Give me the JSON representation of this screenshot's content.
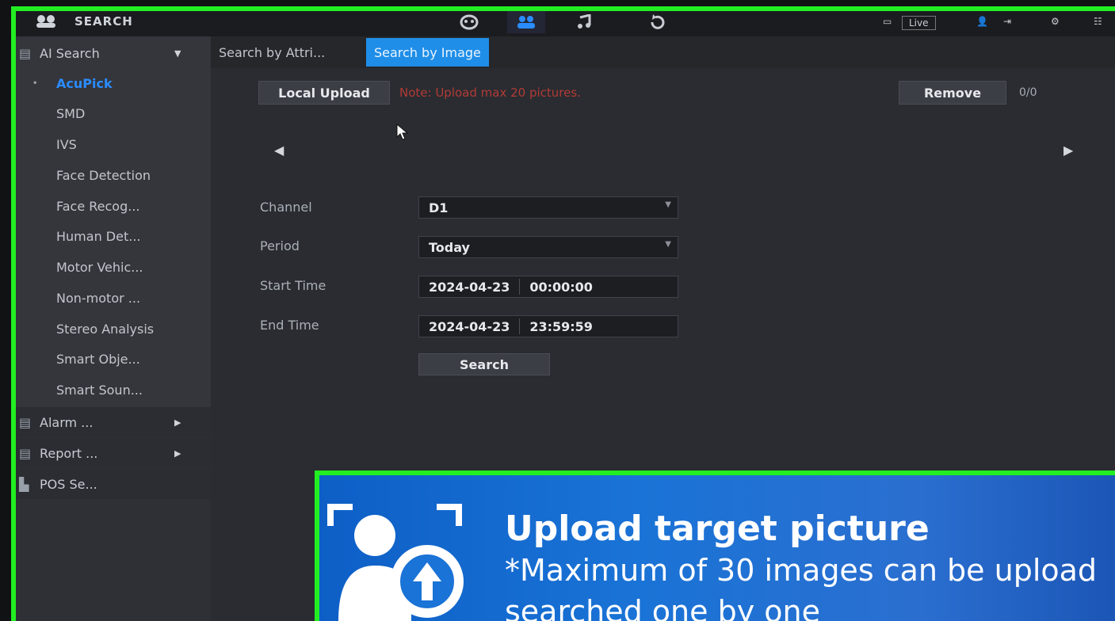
{
  "topbar": {
    "title": "SEARCH",
    "live": "Live"
  },
  "sidebar": {
    "ai_search": "AI Search",
    "sub_items": [
      "AcuPick",
      "SMD",
      "IVS",
      "Face Detection",
      "Face Recog...",
      "Human Det...",
      "Motor Vehic...",
      "Non-motor ...",
      "Stereo Analysis",
      "Smart Obje...",
      "Smart Soun..."
    ],
    "alarm": "Alarm ...",
    "report": "Report ...",
    "pos": "POS Se..."
  },
  "tabs": {
    "by_attr": "Search by Attri...",
    "by_image": "Search by Image"
  },
  "upload": {
    "button": "Local Upload",
    "note": "Note: Upload max 20 pictures.",
    "remove": "Remove",
    "count": "0/0"
  },
  "form": {
    "channel_label": "Channel",
    "channel_value": "D1",
    "period_label": "Period",
    "period_value": "Today",
    "start_label": "Start Time",
    "start_date": "2024-04-23",
    "start_time": "00:00:00",
    "end_label": "End Time",
    "end_date": "2024-04-23",
    "end_time": "23:59:59",
    "search_button": "Search"
  },
  "banner": {
    "title": "Upload target picture",
    "line1": "*Maximum of 30 images can be upload",
    "line2": "searched one by one"
  },
  "colors": {
    "accent": "#1f8ee8",
    "frame_highlight": "#22ee22",
    "note_red": "#b23b36",
    "banner_blue": "#1a73d6"
  }
}
